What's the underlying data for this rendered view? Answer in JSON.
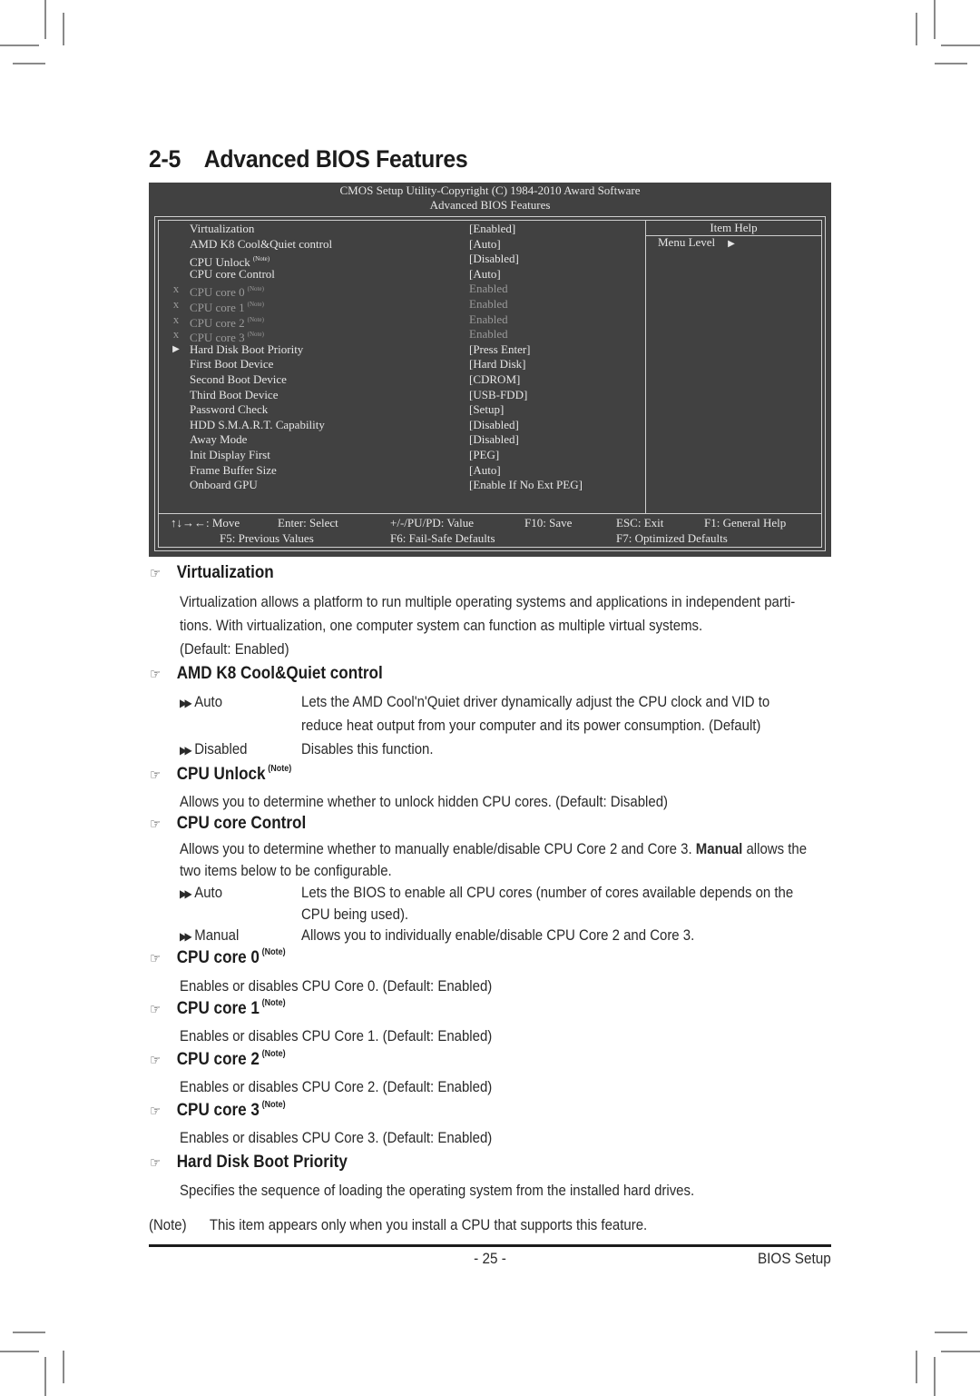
{
  "section": {
    "number": "2-5",
    "title": "Advanced BIOS Features"
  },
  "bios": {
    "header_line1": "CMOS Setup Utility-Copyright (C) 1984-2010 Award Software",
    "header_line2": "Advanced BIOS Features",
    "item_help_title": "Item Help",
    "menu_level_label": "Menu Level",
    "items": [
      {
        "mark": "",
        "label": "Virtualization",
        "note": "",
        "value": "[Enabled]",
        "disabled": false
      },
      {
        "mark": "",
        "label": "AMD K8 Cool&Quiet control",
        "note": "",
        "value": "[Auto]",
        "disabled": false
      },
      {
        "mark": "",
        "label": "CPU Unlock",
        "note": "(Note)",
        "value": "[Disabled]",
        "disabled": false
      },
      {
        "mark": "",
        "label": "CPU core Control",
        "note": "",
        "value": "[Auto]",
        "disabled": false
      },
      {
        "mark": "x",
        "label": "CPU core 0",
        "note": "(Note)",
        "value": "Enabled",
        "disabled": true
      },
      {
        "mark": "x",
        "label": "CPU core 1",
        "note": "(Note)",
        "value": "Enabled",
        "disabled": true
      },
      {
        "mark": "x",
        "label": "CPU core 2",
        "note": "(Note)",
        "value": "Enabled",
        "disabled": true
      },
      {
        "mark": "x",
        "label": "CPU core 3",
        "note": "(Note)",
        "value": "Enabled",
        "disabled": true
      },
      {
        "mark": "▶",
        "label": "Hard Disk Boot Priority",
        "note": "",
        "value": "[Press Enter]",
        "disabled": false
      },
      {
        "mark": "",
        "label": "First Boot Device",
        "note": "",
        "value": "[Hard Disk]",
        "disabled": false
      },
      {
        "mark": "",
        "label": "Second Boot Device",
        "note": "",
        "value": "[CDROM]",
        "disabled": false
      },
      {
        "mark": "",
        "label": "Third Boot Device",
        "note": "",
        "value": "[USB-FDD]",
        "disabled": false
      },
      {
        "mark": "",
        "label": "Password Check",
        "note": "",
        "value": "[Setup]",
        "disabled": false
      },
      {
        "mark": "",
        "label": "HDD S.M.A.R.T. Capability",
        "note": "",
        "value": "[Disabled]",
        "disabled": false
      },
      {
        "mark": "",
        "label": "Away Mode",
        "note": "",
        "value": "[Disabled]",
        "disabled": false
      },
      {
        "mark": "",
        "label": "Init Display First",
        "note": "",
        "value": "[PEG]",
        "disabled": false
      },
      {
        "mark": "",
        "label": "Frame Buffer Size",
        "note": "",
        "value": "[Auto]",
        "disabled": false
      },
      {
        "mark": "",
        "label": "Onboard GPU",
        "note": "",
        "value": "[Enable If No Ext PEG]",
        "disabled": false
      }
    ],
    "footer": {
      "move": "↑↓→←: Move",
      "select": "Enter: Select",
      "value": "+/-/PU/PD: Value",
      "save": "F10: Save",
      "exit": "ESC: Exit",
      "help": "F1: General Help",
      "previous": "F5: Previous Values",
      "failsafe": "F6: Fail-Safe Defaults",
      "optimized": "F7: Optimized Defaults"
    },
    "colors": {
      "background": "#414141",
      "text": "#e6e6e6",
      "dimmed": "#9a9a9a"
    }
  },
  "doc": {
    "note_sup": "(Note)",
    "virtualization": {
      "title": "Virtualization",
      "line1": "Virtualization allows a platform to run multiple operating systems and applications in independent parti-",
      "line2": "tions. With virtualization, one computer system can function as multiple virtual systems.",
      "line3": "(Default: Enabled)"
    },
    "coolquiet": {
      "title": "AMD K8 Cool&Quiet control",
      "options": [
        {
          "name": "Auto",
          "desc1": "Lets the AMD Cool'n'Quiet driver dynamically adjust the CPU clock and VID to",
          "desc2": "reduce heat output from your computer and its power consumption. (Default)"
        },
        {
          "name": "Disabled",
          "desc1": "Disables this function."
        }
      ]
    },
    "cpu_unlock": {
      "title": "CPU Unlock",
      "text": "Allows you to determine whether to unlock hidden CPU cores. (Default: Disabled)"
    },
    "cpu_core_control": {
      "title": "CPU core Control",
      "line1_pre": "Allows you to determine whether to manually enable/disable CPU Core 2 and Core 3. ",
      "line1_bold": "Manual",
      "line1_post": " allows the",
      "line2": "two items below to be configurable.",
      "options": [
        {
          "name": "Auto",
          "desc1": "Lets the BIOS to enable all CPU cores (number of cores available depends on the",
          "desc2": "CPU being used)."
        },
        {
          "name": "Manual",
          "desc1": "Allows you to individually enable/disable CPU Core 2 and Core 3."
        }
      ]
    },
    "cores": [
      {
        "title": "CPU core 0",
        "text": "Enables or disables CPU Core 0. (Default: Enabled)"
      },
      {
        "title": "CPU core 1",
        "text": "Enables or disables CPU Core 1. (Default: Enabled)"
      },
      {
        "title": "CPU core 2",
        "text": "Enables or disables CPU Core 2. (Default: Enabled)"
      },
      {
        "title": "CPU core 3",
        "text": "Enables or disables CPU Core 3. (Default: Enabled)"
      }
    ],
    "hdd_priority": {
      "title": "Hard Disk Boot Priority",
      "text": "Specifies the sequence of loading the operating system from the installed hard drives."
    },
    "footnote": {
      "tag": "(Note)",
      "text": "This item appears only when you install a CPU that supports this feature."
    }
  },
  "footer": {
    "page_number": "- 25 -",
    "chapter": "BIOS Setup"
  }
}
